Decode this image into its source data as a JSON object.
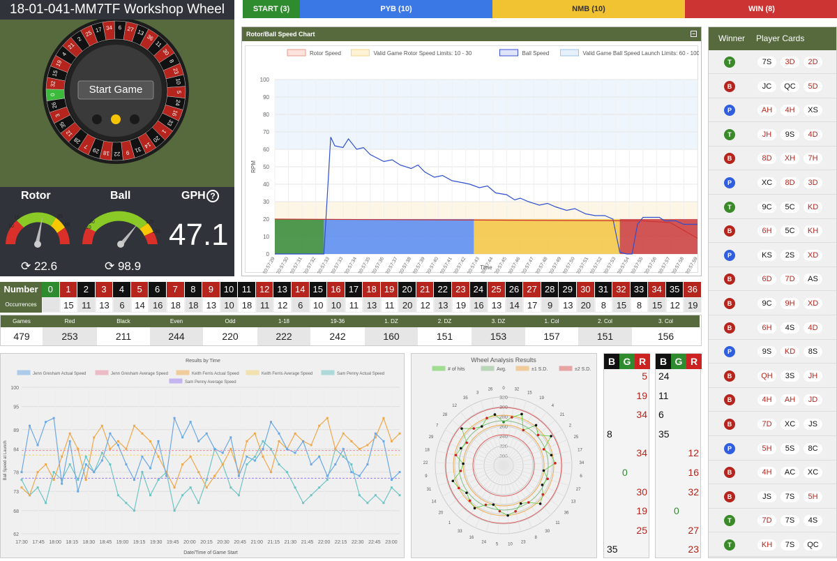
{
  "wheel": {
    "title": "18-01-041-MM7TF Workshop Wheel",
    "start_button": "Start Game",
    "rotor_label": "Rotor",
    "ball_label": "Ball",
    "gph_label": "GPH",
    "help_icon": "question-circle-icon",
    "gph_value": "47.1",
    "rotor_value": "22.6",
    "ball_value": "98.9",
    "rotor_ticks": [
      "10",
      "15",
      "35",
      "40"
    ],
    "ball_ticks": [
      "10",
      "30",
      "120",
      "140"
    ],
    "pocket_numbers": [
      "6",
      "27",
      "13",
      "36",
      "11",
      "30",
      "8",
      "23",
      "10",
      "5",
      "24",
      "16",
      "33",
      "1",
      "20",
      "14",
      "31",
      "9",
      "22",
      "18",
      "29",
      "7",
      "28",
      "12",
      "35",
      "3",
      "26",
      "0",
      "32",
      "15",
      "19",
      "4",
      "21",
      "2",
      "25",
      "17",
      "34"
    ],
    "refresh_icon": "refresh-icon"
  },
  "topbar": [
    {
      "label": "START (3)",
      "color": "#2e8b2e"
    },
    {
      "label": "PYB (10)",
      "color": "#3a78e6"
    },
    {
      "label": "NMB (10)",
      "color": "#f1c232"
    },
    {
      "label": "WIN (8)",
      "color": "#cc3333"
    }
  ],
  "speed_chart": {
    "title": "Rotor/Ball Speed Chart",
    "collapse_icon": "minus-square-icon",
    "legend": [
      "Rotor Speed",
      "Valid Game Rotor Speed Limits: 10 - 30",
      "Ball Speed",
      "Valid Game Ball Speed Launch Limits: 60 - 100"
    ],
    "ylabel": "RPM",
    "xlabel": "Time",
    "yticks": [
      "0",
      "10",
      "20",
      "30",
      "40",
      "50",
      "60",
      "70",
      "80",
      "90",
      "100"
    ],
    "xticks": [
      "20:57:29",
      "20:57:30",
      "20:57:31",
      "20:57:32",
      "20:57:33",
      "20:57:33",
      "20:57:34",
      "20:57:35",
      "20:57:36",
      "20:57:37",
      "20:57:38",
      "20:57:39",
      "20:57:40",
      "20:57:41",
      "20:57:42",
      "20:57:43",
      "20:57:44",
      "20:57:45",
      "20:57:46",
      "20:57:47",
      "20:57:48",
      "20:57:49",
      "20:57:50",
      "20:57:51",
      "20:57:52",
      "20:57:53",
      "20:57:54",
      "20:57:55",
      "20:57:56",
      "20:57:57",
      "20:57:58",
      "20:57:59"
    ]
  },
  "side_panel": {
    "winner_header": "Winner",
    "cards_header": "Player Cards",
    "rows": [
      {
        "w": "T",
        "c": [
          "7S",
          "3D",
          "2D"
        ]
      },
      {
        "w": "B",
        "c": [
          "JC",
          "QC",
          "5D"
        ]
      },
      {
        "w": "P",
        "c": [
          "AH",
          "4H",
          "XS"
        ]
      },
      {
        "w": "T",
        "c": [
          "JH",
          "9S",
          "4D"
        ]
      },
      {
        "w": "B",
        "c": [
          "8D",
          "XH",
          "7H"
        ]
      },
      {
        "w": "P",
        "c": [
          "XC",
          "8D",
          "3D"
        ]
      },
      {
        "w": "T",
        "c": [
          "9C",
          "5C",
          "KD"
        ]
      },
      {
        "w": "B",
        "c": [
          "6H",
          "5C",
          "KH"
        ]
      },
      {
        "w": "P",
        "c": [
          "KS",
          "2S",
          "XD"
        ]
      },
      {
        "w": "B",
        "c": [
          "6D",
          "7D",
          "AS"
        ]
      },
      {
        "w": "B",
        "c": [
          "9C",
          "9H",
          "XD"
        ]
      },
      {
        "w": "B",
        "c": [
          "6H",
          "4S",
          "4D"
        ]
      },
      {
        "w": "P",
        "c": [
          "9S",
          "KD",
          "8S"
        ]
      },
      {
        "w": "B",
        "c": [
          "QH",
          "3S",
          "JH"
        ]
      },
      {
        "w": "B",
        "c": [
          "4H",
          "AH",
          "JD"
        ]
      },
      {
        "w": "B",
        "c": [
          "7D",
          "XC",
          "JS"
        ]
      },
      {
        "w": "P",
        "c": [
          "5H",
          "5S",
          "8C"
        ]
      },
      {
        "w": "B",
        "c": [
          "4H",
          "AC",
          "XC"
        ]
      },
      {
        "w": "B",
        "c": [
          "JS",
          "7S",
          "5H"
        ]
      },
      {
        "w": "T",
        "c": [
          "7D",
          "7S",
          "4S"
        ]
      },
      {
        "w": "T",
        "c": [
          "KH",
          "7S",
          "QC"
        ]
      }
    ]
  },
  "numbers": {
    "label": "Number",
    "occ_label": "Occurrences",
    "occurrences": [
      "15",
      "11",
      "13",
      "6",
      "14",
      "16",
      "18",
      "18",
      "13",
      "10",
      "18",
      "11",
      "12",
      "6",
      "10",
      "10",
      "11",
      "13",
      "11",
      "20",
      "12",
      "13",
      "19",
      "16",
      "13",
      "14",
      "17",
      "9",
      "13",
      "20",
      "8",
      "15",
      "8",
      "15",
      "12",
      "19"
    ]
  },
  "stats": {
    "headers": [
      "Games",
      "Red",
      "Black",
      "Even",
      "Odd",
      "1-18",
      "19-36",
      "1. DZ",
      "2. DZ",
      "3. DZ",
      "1. Col",
      "2. Col",
      "3. Col"
    ],
    "values": [
      "479",
      "253",
      "211",
      "244",
      "220",
      "222",
      "242",
      "160",
      "151",
      "153",
      "157",
      "151",
      "156"
    ]
  },
  "results_chart": {
    "title": "Results by Time",
    "legend": [
      "Jenn Gresham Actual Speed",
      "Jenn Gresham Average Speed",
      "Keith Ferris Actual Speed",
      "Keith Ferris Average Speed",
      "Sam Penny Actual Speed",
      "Sam Penny Average Speed"
    ],
    "ylabel": "Ball Speed at Launch",
    "xlabel": "Date/Time of Game Start",
    "yticks": [
      "62",
      "68",
      "73",
      "78",
      "84",
      "89",
      "95",
      "100"
    ],
    "xticks": [
      "17:30",
      "17:45",
      "18:00",
      "18:15",
      "18:30",
      "18:45",
      "19:00",
      "19:15",
      "19:30",
      "19:45",
      "20:00",
      "20:15",
      "20:30",
      "20:45",
      "21:00",
      "21:15",
      "21:30",
      "21:45",
      "22:00",
      "22:15",
      "22:30",
      "22:45",
      "23:00"
    ]
  },
  "polar_chart": {
    "title": "Wheel Analysis Results",
    "legend": [
      "# of hits",
      "Avg.",
      "±1 S.D.",
      "±2 S.D."
    ],
    "rticks": [
      "200",
      "220",
      "240",
      "260",
      "280",
      "300",
      "320"
    ],
    "numbers": [
      "0",
      "32",
      "15",
      "19",
      "4",
      "21",
      "2",
      "25",
      "17",
      "34",
      "6",
      "27",
      "13",
      "36",
      "11",
      "30",
      "8",
      "23",
      "10",
      "5",
      "24",
      "16",
      "33",
      "1",
      "20",
      "14",
      "31",
      "9",
      "22",
      "18",
      "29",
      "7",
      "28",
      "12",
      "35",
      "3",
      "26"
    ]
  },
  "history_left": {
    "headers": [
      "B",
      "G",
      "R"
    ],
    "rows": [
      {
        "col": "R",
        "v": "5"
      },
      {
        "col": "R",
        "v": "19"
      },
      {
        "col": "R",
        "v": "34"
      },
      {
        "col": "B",
        "v": "8"
      },
      {
        "col": "R",
        "v": "34"
      },
      {
        "col": "G",
        "v": "0"
      },
      {
        "col": "R",
        "v": "30"
      },
      {
        "col": "R",
        "v": "19"
      },
      {
        "col": "R",
        "v": "25"
      },
      {
        "col": "B",
        "v": "35"
      }
    ]
  },
  "history_right": {
    "headers": [
      "B",
      "G",
      "R"
    ],
    "rows": [
      {
        "col": "B",
        "v": "24"
      },
      {
        "col": "B",
        "v": "11"
      },
      {
        "col": "B",
        "v": "6"
      },
      {
        "col": "B",
        "v": "35"
      },
      {
        "col": "R",
        "v": "12"
      },
      {
        "col": "R",
        "v": "16"
      },
      {
        "col": "R",
        "v": "32"
      },
      {
        "col": "G",
        "v": "0"
      },
      {
        "col": "R",
        "v": "27"
      },
      {
        "col": "R",
        "v": "23"
      }
    ]
  }
}
